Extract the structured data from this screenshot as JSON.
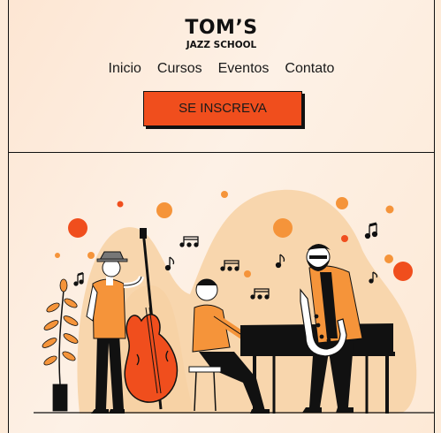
{
  "brand": {
    "name": "TOM’S",
    "tagline": "JAZZ SCHOOL"
  },
  "nav": {
    "items": [
      {
        "label": "Inicio"
      },
      {
        "label": "Cursos"
      },
      {
        "label": "Eventos"
      },
      {
        "label": "Contato"
      }
    ]
  },
  "cta": {
    "label": "SE INSCREVA"
  },
  "colors": {
    "accent": "#f04e1d",
    "background": "#fdebd9",
    "blob": "#f8d6ad",
    "dot": "#f5943a"
  },
  "hero": {
    "image": "jazz-band-illustration"
  }
}
